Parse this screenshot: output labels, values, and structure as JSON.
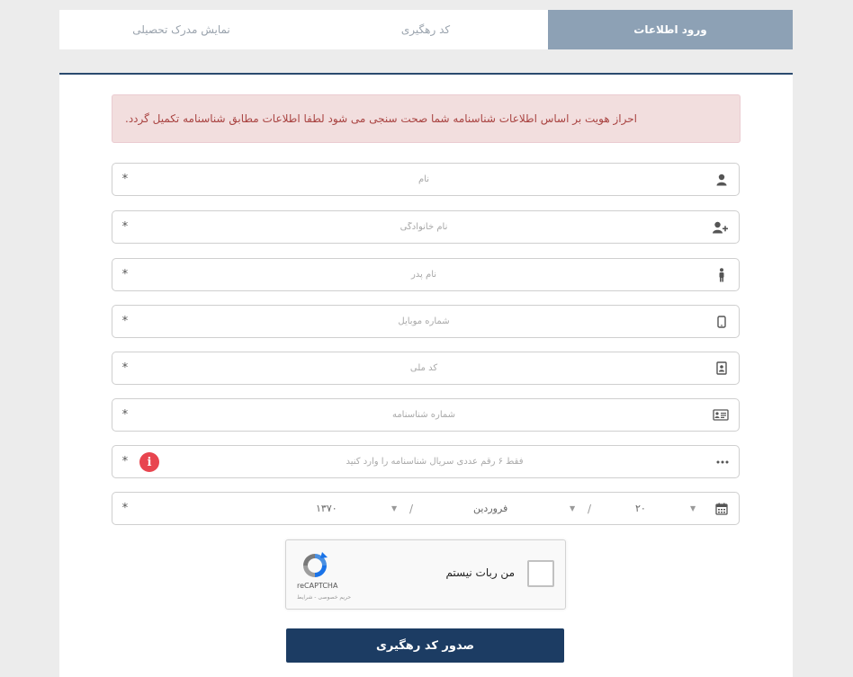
{
  "tabs": [
    {
      "label": "ورود اطلاعات",
      "active": true
    },
    {
      "label": "کد رهگیری",
      "active": false
    },
    {
      "label": "نمایش مدرک تحصیلی",
      "active": false
    }
  ],
  "alert": {
    "text": "احراز هویت بر اساس اطلاعات شناسنامه شما صحت سنجی می شود لطفا اطلاعات مطابق شناسنامه تکمیل گردد."
  },
  "fields": {
    "first_name": {
      "placeholder": "نام",
      "icon": "user-icon",
      "required": "*"
    },
    "last_name": {
      "placeholder": "نام خانوادگی",
      "icon": "user-plus-icon",
      "required": "*"
    },
    "father_name": {
      "placeholder": "نام پدر",
      "icon": "person-standing-icon",
      "required": "*"
    },
    "mobile": {
      "placeholder": "شماره موبایل",
      "icon": "mobile-phone-icon",
      "required": "*"
    },
    "national_code": {
      "placeholder": "کد ملی",
      "icon": "id-badge-icon",
      "required": "*"
    },
    "id_number": {
      "placeholder": "شماره شناسنامه",
      "icon": "id-card-icon",
      "required": "*"
    },
    "serial": {
      "placeholder": "فقط ۶ رقم عددی سریال شناسنامه را وارد کنید",
      "icon": "ellipsis-icon",
      "required": "*",
      "info_badge": "i"
    },
    "birth_date": {
      "day": "۲۰",
      "month": "فروردین",
      "year": "۱۳۷۰",
      "separator": "/",
      "icon": "calendar-icon",
      "required": "*"
    }
  },
  "captcha": {
    "label": "من ربات نیستم",
    "brand": "reCAPTCHA",
    "terms": "حریم خصوصی - شرایط"
  },
  "submit": {
    "label": "صدور کد رهگیری"
  },
  "colors": {
    "active_tab": "#8da1b5",
    "submit": "#1c3c63",
    "alert_bg": "#f2dede",
    "alert_text": "#a94442",
    "info_badge": "#e8454f"
  }
}
